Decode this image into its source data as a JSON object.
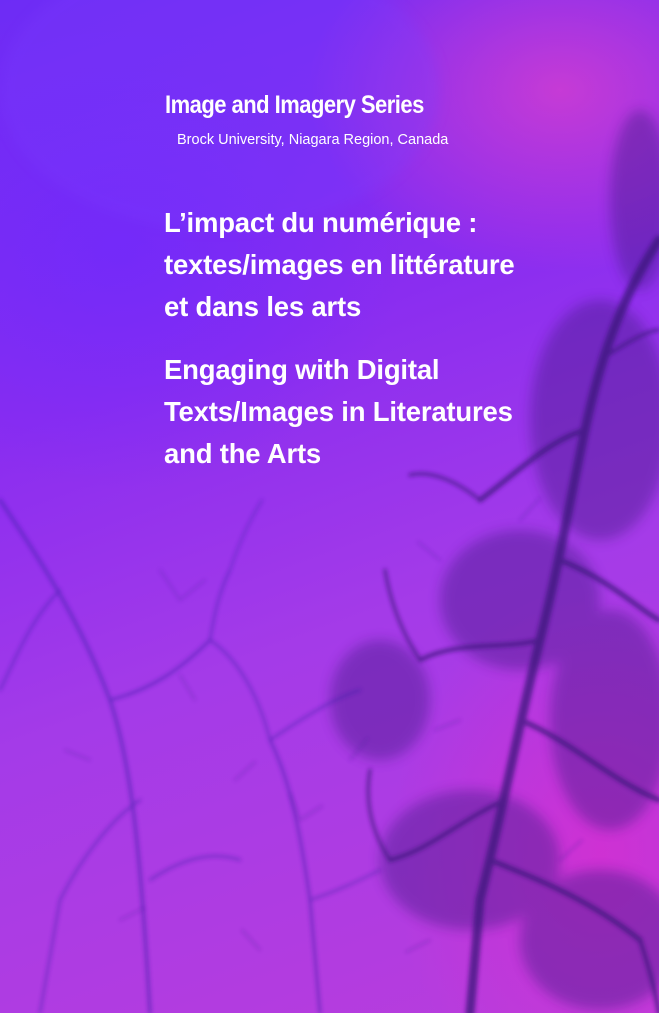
{
  "series": {
    "title": "Image and Imagery Series",
    "subtitle": "Brock University, Niagara Region, Canada"
  },
  "title_fr": {
    "lines": [
      "L’impact du numérique :",
      "textes/images en littérature",
      "et dans les arts"
    ]
  },
  "title_en": {
    "lines": [
      "Engaging with Digital",
      "Texts/Images in Literatures",
      "and the Arts"
    ]
  },
  "colors": {
    "background_violet": "#6d2cf5",
    "background_magenta": "#b93ddc",
    "branch_shadow": "#3a157a",
    "text": "#ffffff"
  }
}
